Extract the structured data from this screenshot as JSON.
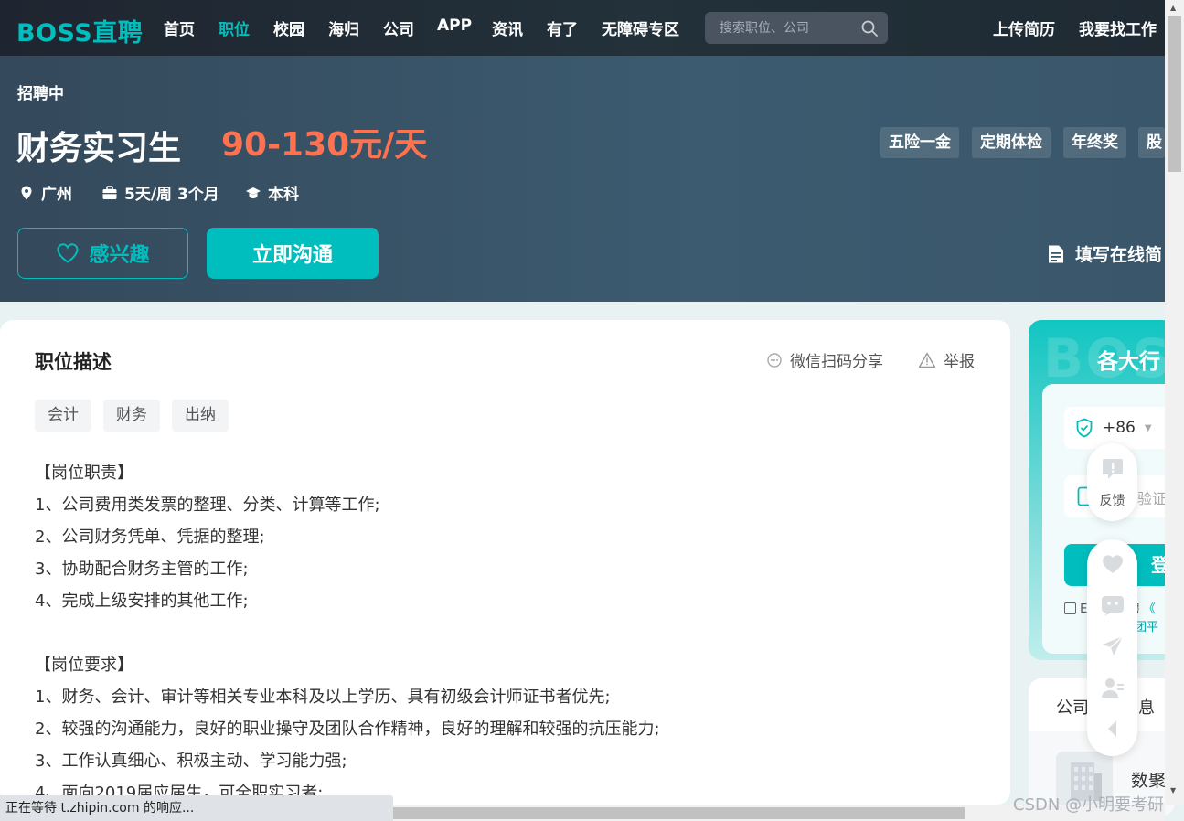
{
  "nav": {
    "logo": "BOSS直聘",
    "items": [
      "首页",
      "职位",
      "校园",
      "海归",
      "公司",
      "APP",
      "资讯",
      "有了",
      "无障碍专区"
    ],
    "active_item": "职位",
    "search_placeholder": "搜索职位、公司",
    "right_links": [
      "上传简历",
      "我要找工作"
    ]
  },
  "job": {
    "status": "招聘中",
    "title": "财务实习生",
    "salary": "90-130元/天",
    "location": "广州",
    "schedule": "5天/周 3个月",
    "education": "本科",
    "benefits": [
      "五险一金",
      "定期体检",
      "年终奖",
      "股"
    ],
    "interest_label": "感兴趣",
    "chat_label": "立即沟通",
    "online_resume_label": "填写在线简"
  },
  "description": {
    "title": "职位描述",
    "share_label": "微信扫码分享",
    "report_label": "举报",
    "tags": [
      "会计",
      "财务",
      "出纳"
    ],
    "lines": [
      "【岗位职责】",
      "1、公司费用类发票的整理、分类、计算等工作;",
      "2、公司财务凭单、凭据的整理;",
      "3、协助配合财务主管的工作;",
      "4、完成上级安排的其他工作;",
      "",
      "【岗位要求】",
      "1、财务、会计、审计等相关专业本科及以上学历、具有初级会计师证书者优先;",
      "2、较强的沟通能力，良好的职业操守及团队合作精神，良好的理解和较强的抗压能力;",
      "3、工作认真细心、积极主动、学习能力强;",
      "4、面向2019届应届生，可全职实习者;"
    ]
  },
  "login_panel": {
    "watermark": "BOSS",
    "title": "各大行",
    "country_code": "+86",
    "code_placeholder": "验证",
    "login_label": "登",
    "agree_prefix": "E",
    "agree_text": "聘",
    "agree_link1": "《",
    "agree_link2": "集团平"
  },
  "company_panel": {
    "title": "公司基本信息",
    "name": "数聚"
  },
  "float_toolbar": {
    "feedback_label": "反馈"
  },
  "status_bar": "正在等待 t.zhipin.com 的响应...",
  "watermark_text": "CSDN @小明要考研",
  "colors": {
    "brand": "#00bebd",
    "salary": "#ff7250",
    "banner": "#3a566a"
  }
}
